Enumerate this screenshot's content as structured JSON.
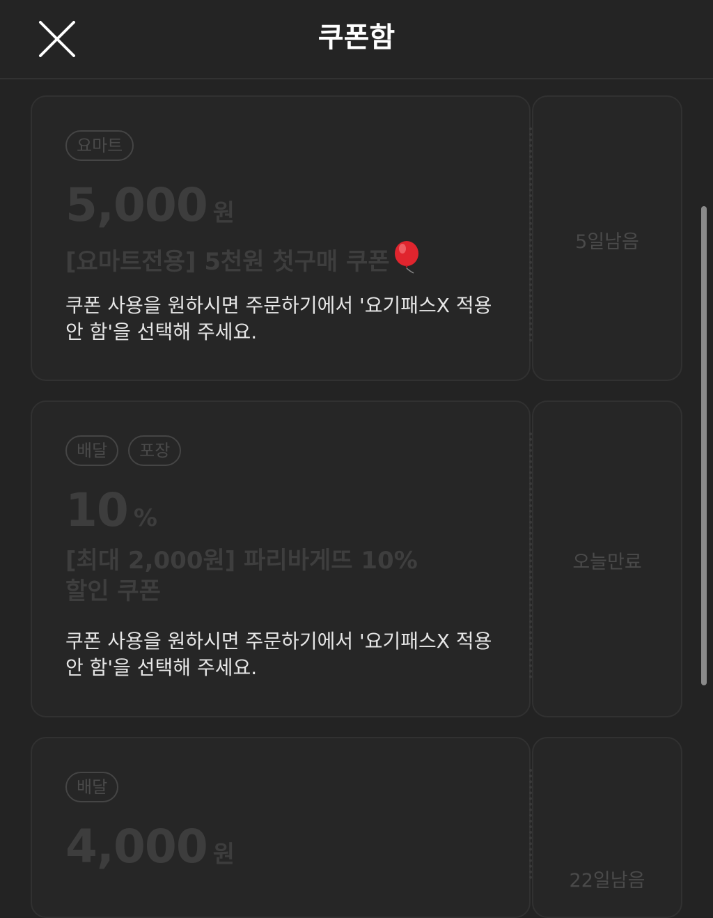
{
  "header": {
    "title": "쿠폰함",
    "close_icon": "close-icon"
  },
  "coupons": [
    {
      "tags": [
        "요마트"
      ],
      "amount": "5,000",
      "unit": "원",
      "title": "[요마트전용] 5천원 첫구매 쿠폰",
      "title_icon": "balloon-icon",
      "note": "쿠폰 사용을 원하시면 주문하기에서 '요기패스X 적용 안 함'을 선택해 주세요.",
      "remaining": "5일남음"
    },
    {
      "tags": [
        "배달",
        "포장"
      ],
      "amount": "10",
      "unit": "%",
      "title": "[최대 2,000원] 파리바게뜨 10% 할인 쿠폰",
      "note": "쿠폰 사용을 원하시면 주문하기에서 '요기패스X 적용 안 함'을 선택해 주세요.",
      "remaining": "오늘만료"
    },
    {
      "tags": [
        "배달"
      ],
      "amount": "4,000",
      "unit": "원",
      "remaining": "22일남음"
    }
  ],
  "colors": {
    "background": "#232323",
    "card": "#262626",
    "disabled_text": "#3e3e3e",
    "note_text": "#e6e6e6",
    "balloon": "#e0252e"
  }
}
